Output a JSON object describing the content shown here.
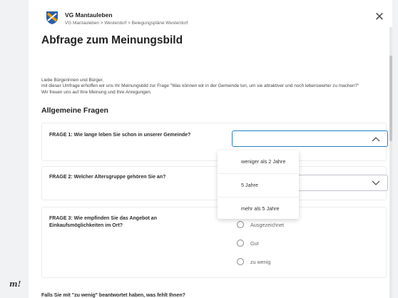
{
  "brand": {
    "logo_text": "m!"
  },
  "header": {
    "org_name": "VG Mantauleben",
    "breadcrumb": "VG Mantauleben > Westerdorf > Belegungspläne Westerdorf"
  },
  "page": {
    "title": "Abfrage zum Meinungsbild",
    "intro": [
      "Liebe Bürgerinnen und Bürger,",
      "mit dieser Umfrage erhoffen wir uns Ihr Meinungsbild zur Frage \"Was können wir in der Gemeinde tun, um sie attraktiver und noch lebenswerter zu machen?\"",
      "Wir freuen uns auf Ihre Meinung und Ihre Anregungen."
    ],
    "section_title": "Allgemeine Fragen"
  },
  "questions": {
    "q1": {
      "label": "FRAGE 1: Wie lange leben Sie schon in unserer Gemeinde?",
      "value": "",
      "options": [
        "weniger als 2 Jahre",
        "5 Jahre",
        "mehr als 5 Jahre"
      ]
    },
    "q2": {
      "label": "FRAGE 2: Welcher Altersgruppe gehören Sie an?",
      "value": ""
    },
    "q3": {
      "label": "FRAGE 3: Wie empfinden Sie das Angebot an Einkaufsmöglichkeiten im Ort?",
      "options": [
        "Ausgezeichnet",
        "Gut",
        "zu wenig"
      ]
    },
    "q4": {
      "label": "Falls Sie mit \"zu wenig\" beantwortet haben, was fehlt Ihnen?"
    }
  },
  "icons": {
    "close": "close-icon",
    "chevron": "chevron-icon",
    "logo": "municipality-logo-icon"
  },
  "colors": {
    "accent": "#2680c2",
    "logo_blue": "#2c5fa8",
    "logo_orange": "#f0a000"
  }
}
